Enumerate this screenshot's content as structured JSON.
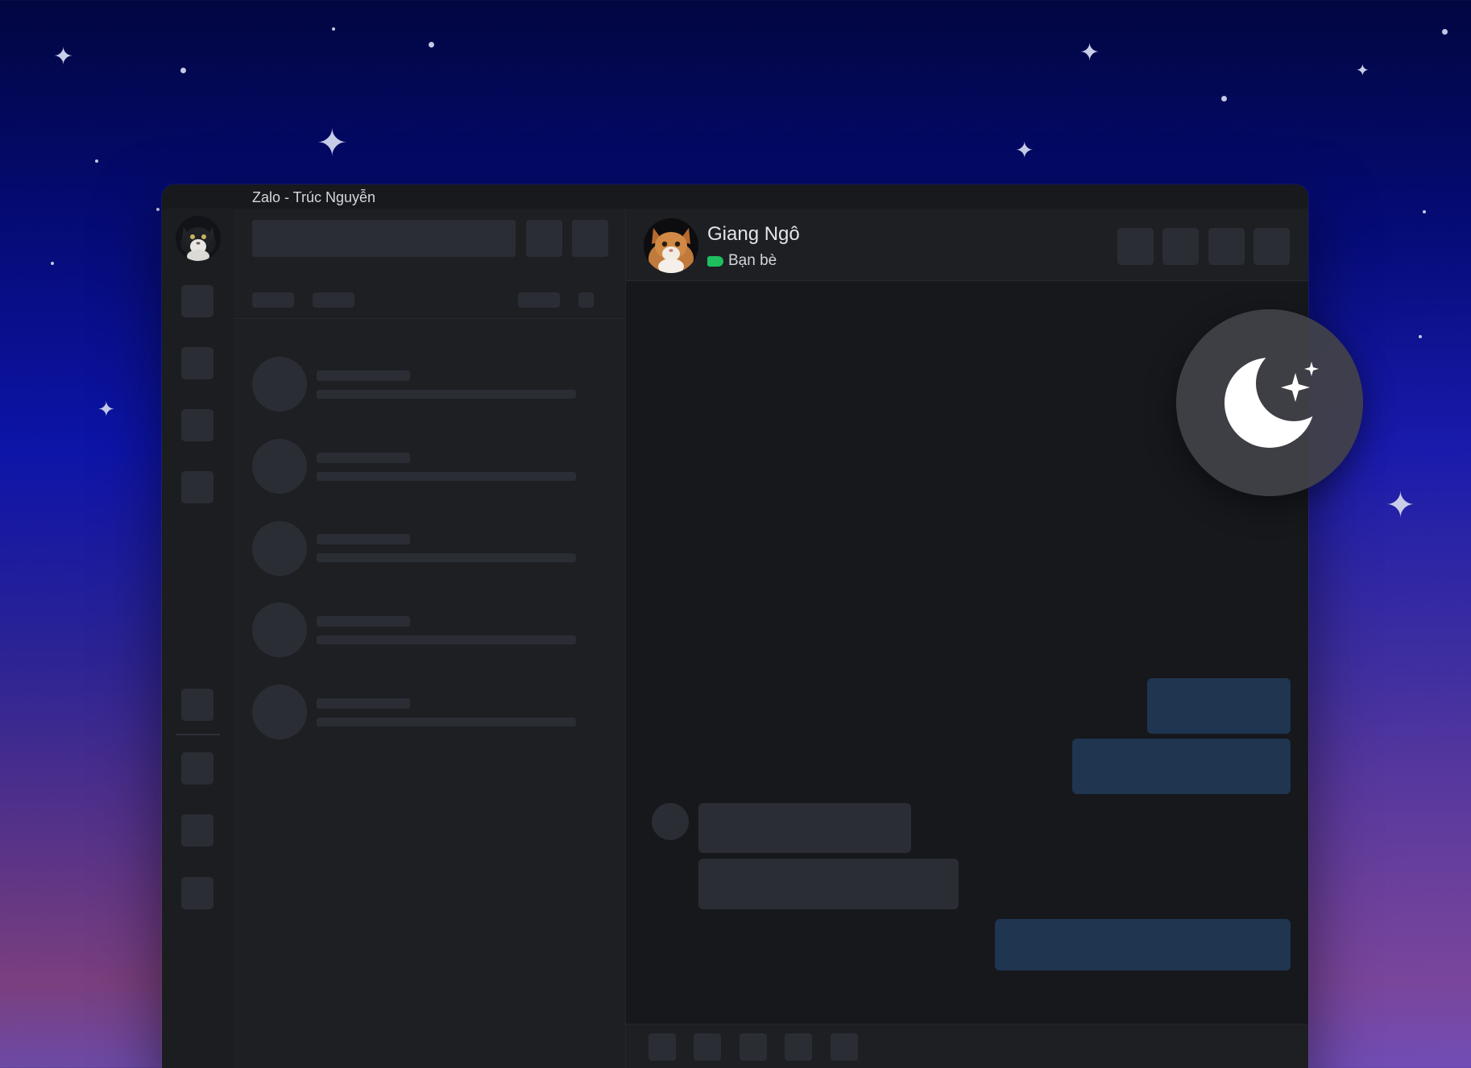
{
  "window": {
    "title": "Zalo - Trúc Nguyễn"
  },
  "chat": {
    "contact_name": "Giang Ngô",
    "contact_tag": "Bạn bè"
  },
  "colors": {
    "tag_green": "#1fbf5f",
    "my_bubble": "#1f3550",
    "their_bubble": "#2a2e34"
  },
  "icons": {
    "night_mode": "moon-stars-icon"
  }
}
